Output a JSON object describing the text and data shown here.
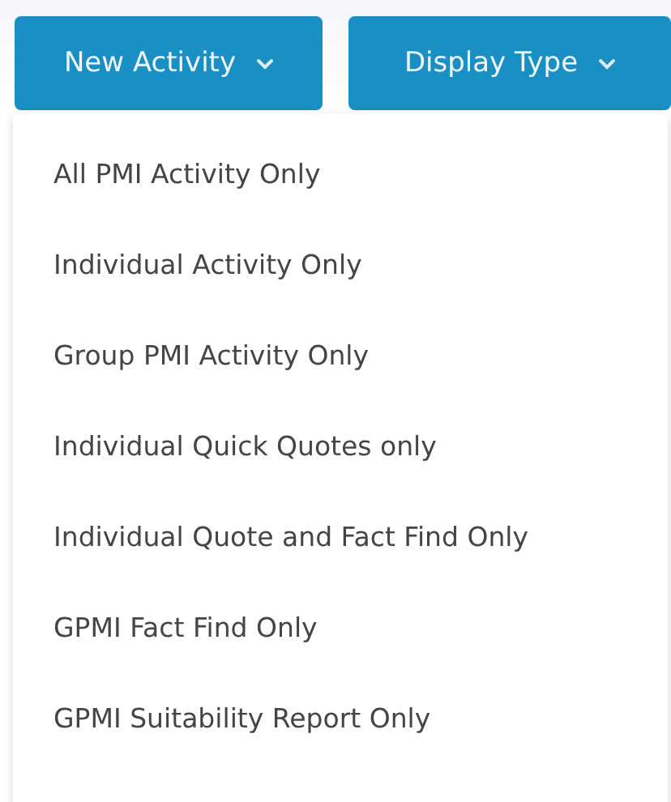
{
  "buttons": [
    {
      "label": "New Activity"
    },
    {
      "label": "Display Type"
    }
  ],
  "menu": {
    "items": [
      {
        "label": "All PMI Activity Only"
      },
      {
        "label": "Individual Activity Only"
      },
      {
        "label": "Group PMI Activity Only"
      },
      {
        "label": "Individual Quick Quotes only"
      },
      {
        "label": "Individual Quote and Fact Find Only"
      },
      {
        "label": "GPMI Fact Find Only"
      },
      {
        "label": "GPMI Suitability Report Only"
      }
    ]
  }
}
